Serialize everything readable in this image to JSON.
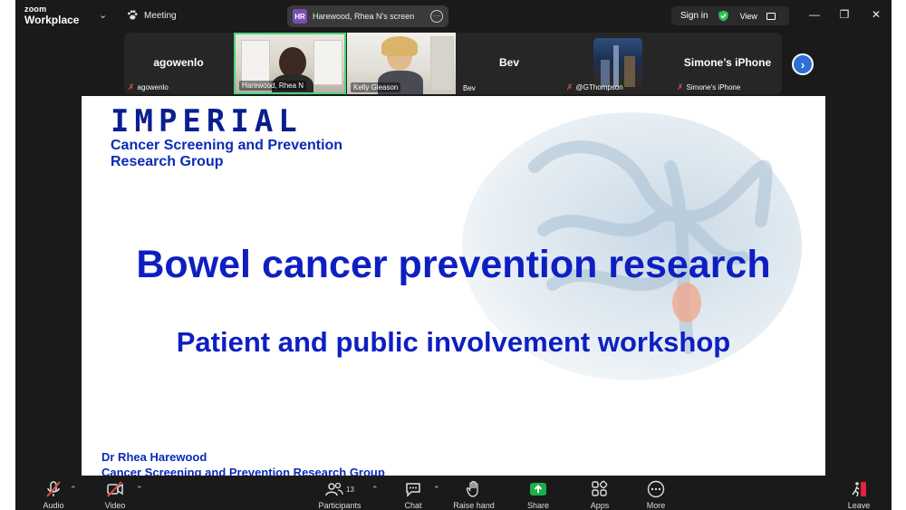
{
  "app": {
    "logo_line1": "zoom",
    "logo_line2": "Workplace",
    "meeting_label": "Meeting"
  },
  "share_banner": {
    "initials": "HR",
    "label": "Harewood, Rhea N's screen"
  },
  "account": {
    "sign_in": "Sign in",
    "view": "View"
  },
  "participants_strip": [
    {
      "display": "agowenlo",
      "name": "agowenlo",
      "muted": true,
      "video": false
    },
    {
      "display": "",
      "name": "Harewood, Rhea N",
      "muted": false,
      "video": true,
      "active_speaker": true
    },
    {
      "display": "",
      "name": "Kelly Gleason",
      "muted": false,
      "video": true
    },
    {
      "display": "Bev",
      "name": "Bev",
      "muted": false,
      "video": false
    },
    {
      "display": "",
      "name": "@GThompson",
      "muted": true,
      "video": false,
      "avatar": "city-skyline"
    },
    {
      "display": "Simone’s iPhone",
      "name": "Simone's iPhone",
      "muted": true,
      "video": false
    }
  ],
  "slide": {
    "org_name": "IMPERIAL",
    "group_name": "Cancer Screening and Prevention Research Group",
    "title": "Bowel cancer prevention research",
    "subtitle": "Patient and public involvement workshop",
    "presenter": "Dr Rhea Harewood",
    "presenter_group": "Cancer Screening and Prevention Research Group"
  },
  "toolbar": {
    "audio": "Audio",
    "video": "Video",
    "participants": "Participants",
    "participants_count": "13",
    "chat": "Chat",
    "raise_hand": "Raise hand",
    "share": "Share",
    "apps": "Apps",
    "more": "More",
    "leave": "Leave"
  },
  "colors": {
    "slide_blue": "#0e1fc2",
    "imperial_navy": "#0a1f8f",
    "share_green": "#19b04a",
    "leave_red": "#e0243a",
    "speaker_green": "#4fd37a"
  }
}
